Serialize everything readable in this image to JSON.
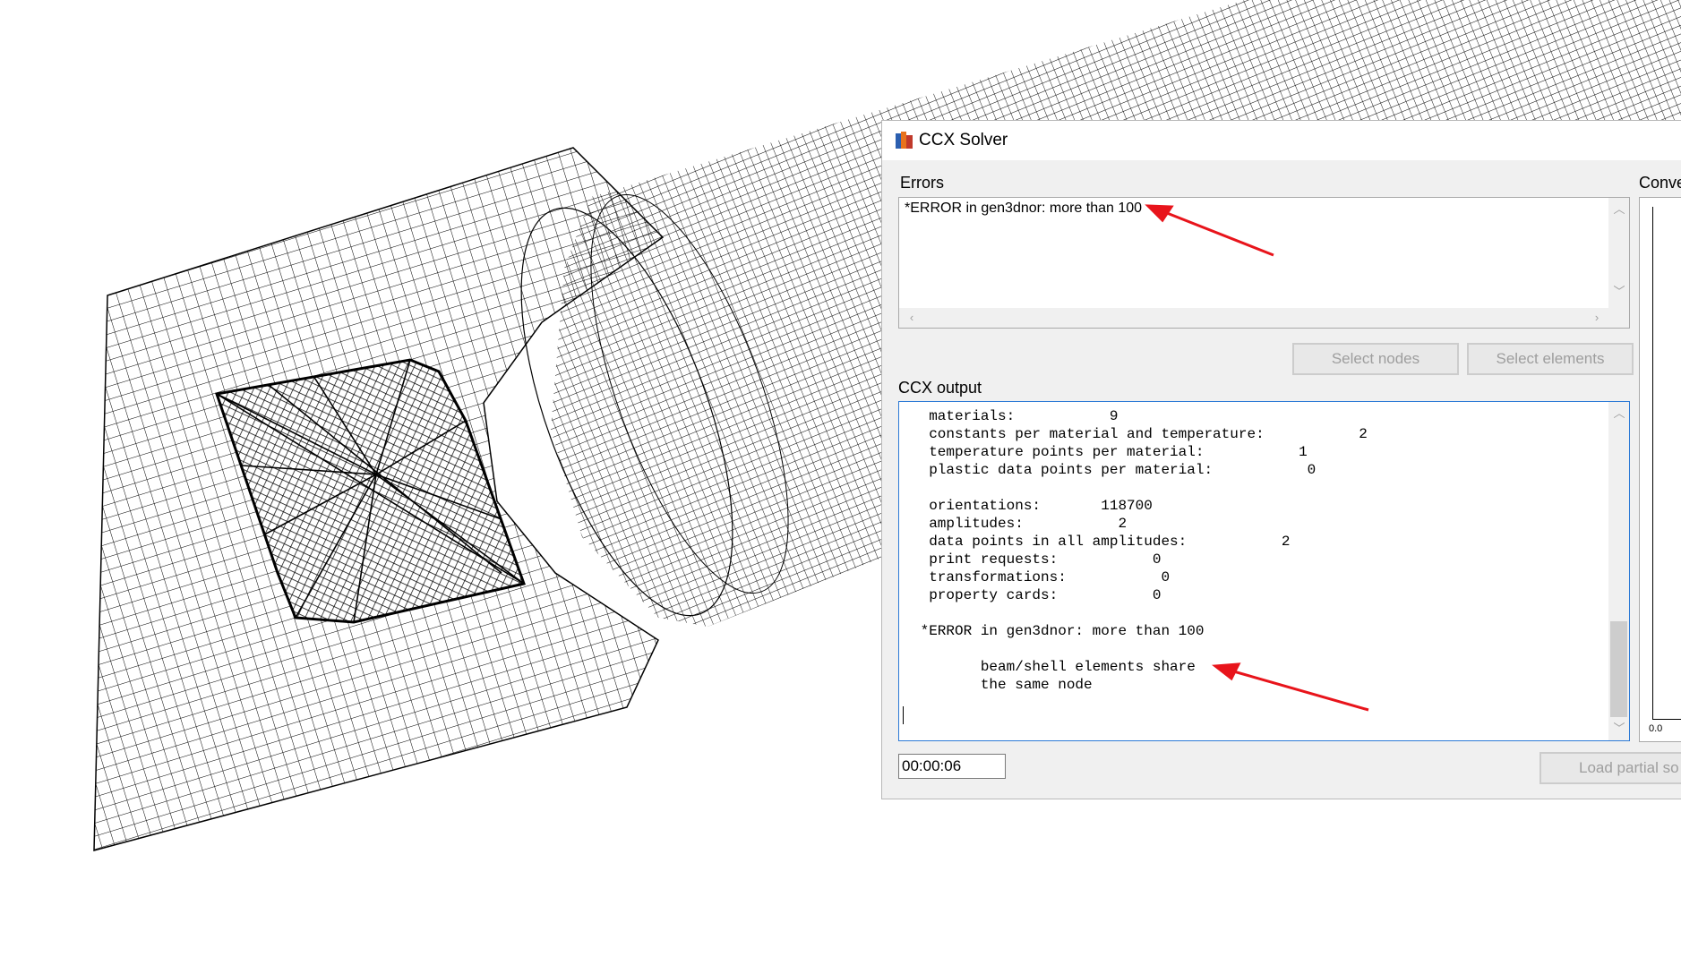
{
  "window": {
    "title": "CCX Solver",
    "icon": "ccx-app-icon"
  },
  "errors": {
    "label": "Errors",
    "text": "*ERROR in gen3dnor: more than 100"
  },
  "buttons": {
    "select_nodes": "Select nodes",
    "select_elements": "Select elements",
    "load_partial": "Load partial so"
  },
  "output": {
    "label": "CCX output",
    "lines": [
      "  materials:           9",
      "  constants per material and temperature:           2",
      "  temperature points per material:           1",
      "  plastic data points per material:           0",
      "",
      "  orientations:       118700",
      "  amplitudes:           2",
      "  data points in all amplitudes:           2",
      "  print requests:           0",
      "  transformations:           0",
      "  property cards:           0",
      "",
      " *ERROR in gen3dnor: more than 100",
      "",
      "        beam/shell elements share",
      "        the same node"
    ]
  },
  "timer": "00:00:06",
  "convergence": {
    "label": "Conve",
    "axis_tick": "0.0"
  },
  "colors": {
    "annotation_arrow": "#e8141b",
    "accent_border": "#2d7ad6"
  }
}
